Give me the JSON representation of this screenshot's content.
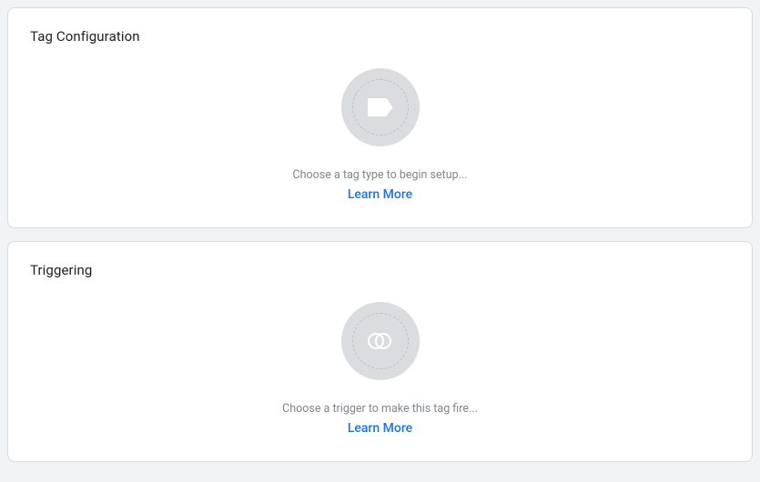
{
  "sections": {
    "tagConfig": {
      "title": "Tag Configuration",
      "hint": "Choose a tag type to begin setup...",
      "learnMore": "Learn More"
    },
    "triggering": {
      "title": "Triggering",
      "hint": "Choose a trigger to make this tag fire...",
      "learnMore": "Learn More"
    }
  }
}
